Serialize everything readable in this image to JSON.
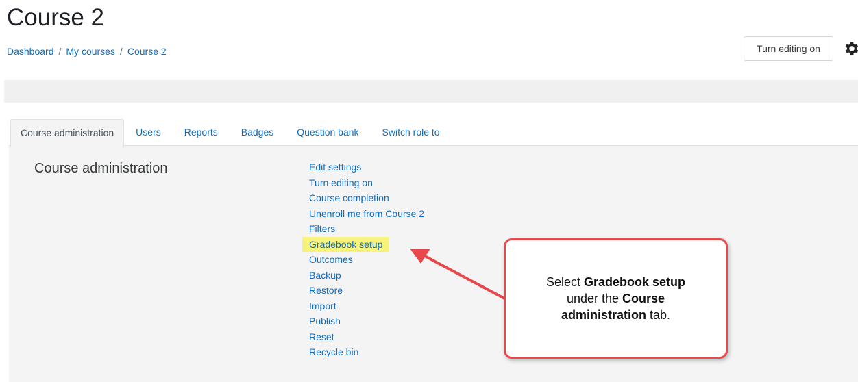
{
  "page": {
    "title": "Course 2"
  },
  "breadcrumb": [
    {
      "label": "Dashboard"
    },
    {
      "label": "My courses"
    },
    {
      "label": "Course 2"
    }
  ],
  "breadcrumb_separator": "/",
  "header": {
    "edit_button_label": "Turn editing on",
    "settings_icon": "gear-icon"
  },
  "tabs": [
    {
      "label": "Course administration",
      "active": true
    },
    {
      "label": "Users"
    },
    {
      "label": "Reports"
    },
    {
      "label": "Badges"
    },
    {
      "label": "Question bank"
    },
    {
      "label": "Switch role to"
    }
  ],
  "section": {
    "heading": "Course administration",
    "items": [
      {
        "label": "Edit settings"
      },
      {
        "label": "Turn editing on"
      },
      {
        "label": "Course completion"
      },
      {
        "label": "Unenroll me from Course 2"
      },
      {
        "label": "Filters"
      },
      {
        "label": "Gradebook setup",
        "highlighted": true
      },
      {
        "label": "Outcomes"
      },
      {
        "label": "Backup"
      },
      {
        "label": "Restore"
      },
      {
        "label": "Import"
      },
      {
        "label": "Publish"
      },
      {
        "label": "Reset"
      },
      {
        "label": "Recycle bin"
      }
    ]
  },
  "annotation": {
    "parts": [
      {
        "text": "Select ",
        "bold": false
      },
      {
        "text": "Gradebook setup",
        "bold": true
      },
      {
        "text": " under the ",
        "bold": false
      },
      {
        "text": "Course administration",
        "bold": true
      },
      {
        "text": " tab.",
        "bold": false
      }
    ],
    "border_color": "#e8474c",
    "highlight_color": "#f7f37a"
  },
  "colors": {
    "link": "#0f6cbf",
    "text": "#373a3c"
  }
}
